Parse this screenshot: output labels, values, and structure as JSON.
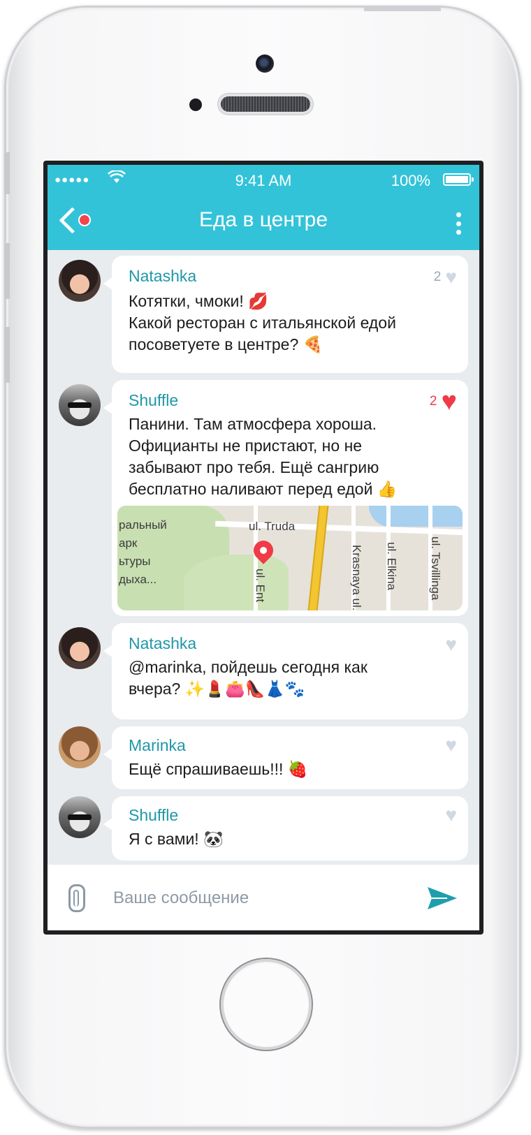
{
  "status": {
    "signal": "●●●●●",
    "wifi": "wifi-icon",
    "time": "9:41 AM",
    "battery": "100%"
  },
  "header": {
    "title": "Еда в центре",
    "accent_color": "#33c3d9"
  },
  "messages": [
    {
      "author": "Natashka",
      "text": "Котятки, чмоки! 💋\nКакой ресторан с итальянской едой посоветуете в центре?  🍕",
      "likes": "2",
      "liked": false
    },
    {
      "author": "Shuffle",
      "text": "Панини. Там атмосфера хороша. Официанты не пристают, но не забывают про тебя. Ещё сангрию бесплатно наливают перед едой  👍",
      "likes": "2",
      "liked": true,
      "map": {
        "labels": [
          "ральный",
          "арк",
          "ьтуры",
          "дыха...",
          "ul. Truda",
          "Krasnaya ul.",
          "ul. Elkina",
          "ul. Tsvillinga",
          "ul. Ent"
        ]
      }
    },
    {
      "author": "Natashka",
      "text": "@marinka, пойдешь сегодня как вчера? ✨💄👛👠👗🐾",
      "likes": "",
      "liked": false
    },
    {
      "author": "Marinka",
      "text": "Ещё спрашиваешь!!!  🍓",
      "likes": "",
      "liked": false
    },
    {
      "author": "Shuffle",
      "text": "Я с вами!  🐼",
      "likes": "",
      "liked": false
    }
  ],
  "composer": {
    "placeholder": "Ваше сообщение",
    "attach_icon": "paperclip-icon",
    "send_icon": "send-icon"
  }
}
